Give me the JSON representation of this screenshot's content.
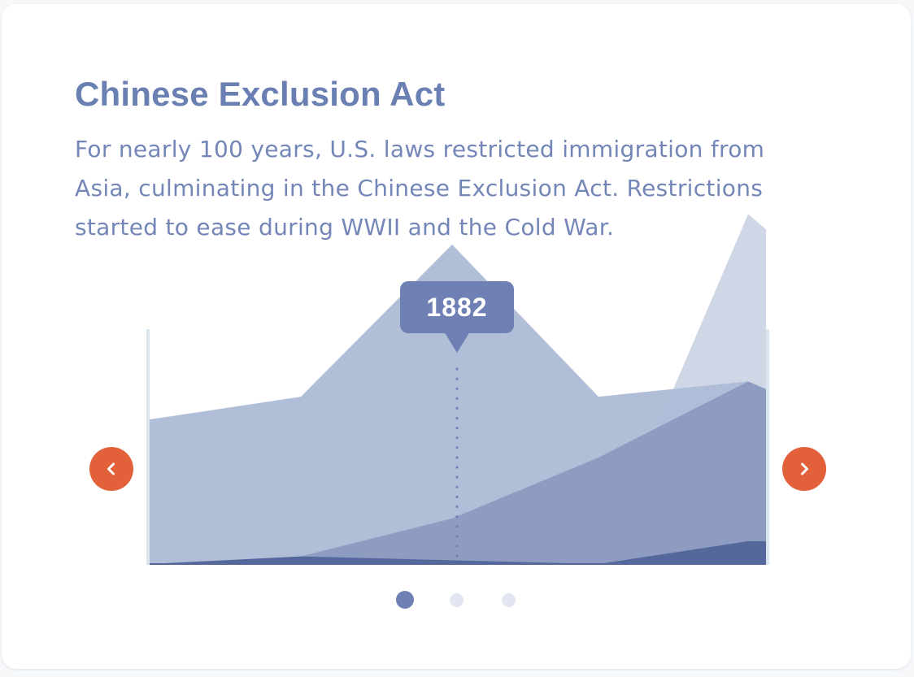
{
  "card": {
    "title": "Chinese Exclusion Act",
    "description": "For nearly 100 years, U.S. laws restricted immigration from Asia, culminating in the Chinese Exclusion Act. Restrictions started to ease during WWII and the Cold War."
  },
  "tooltip": {
    "label": "1882"
  },
  "navigation": {
    "prev_icon": "chevron-left-icon",
    "next_icon": "chevron-right-icon"
  },
  "pagination": {
    "total": 3,
    "active_index": 0
  },
  "colors": {
    "title": "#6a7fb2",
    "text": "#7486b7",
    "accent": "#e2613a",
    "tooltip": "#6e80b4",
    "dot_active": "#6e80b4",
    "dot_inactive": "#e1e6f1"
  },
  "chart_data": {
    "type": "area",
    "x": [
      0,
      1,
      2,
      3,
      4,
      5
    ],
    "marker_index": 2,
    "series": [
      {
        "values": [
          0,
          0,
          0,
          0,
          460,
          440
        ],
        "color": "#cfd6e6"
      },
      {
        "values": [
          190,
          220,
          420,
          220,
          240,
          230
        ],
        "color": "#aebcd7"
      },
      {
        "values": [
          0,
          10,
          60,
          140,
          240,
          230
        ],
        "color": "#8c9bc0"
      },
      {
        "values": [
          0,
          10,
          5,
          0,
          30,
          30
        ],
        "color": "#54669a"
      }
    ],
    "ylim": [
      0,
      500
    ]
  }
}
